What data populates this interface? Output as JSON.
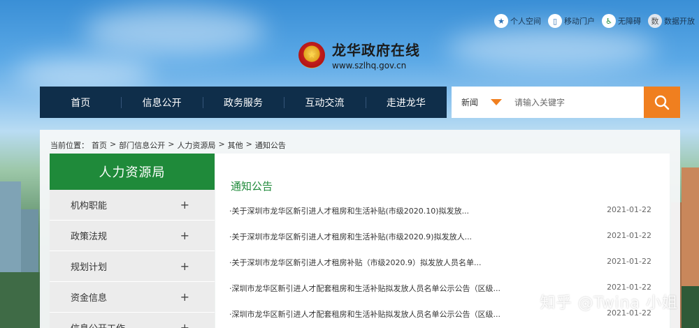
{
  "toplinks": [
    {
      "label": "个人空间",
      "icon": "star-person-icon"
    },
    {
      "label": "移动门户",
      "icon": "mobile-icon"
    },
    {
      "label": "无障碍",
      "icon": "wheelchair-icon"
    },
    {
      "label": "数据开放",
      "icon": "data-icon",
      "icon_text": "数"
    }
  ],
  "logo": {
    "title": "龙华政府在线",
    "url": "www.szlhq.gov.cn"
  },
  "nav": [
    "首页",
    "信息公开",
    "政务服务",
    "互动交流",
    "走进龙华"
  ],
  "search": {
    "category": "新闻",
    "placeholder": "请输入关键字"
  },
  "breadcrumb": {
    "prefix": "当前位置：",
    "items": [
      "首页",
      "部门信息公开",
      "人力资源局",
      "其他",
      "通知公告"
    ],
    "separator": ">"
  },
  "sidebar": {
    "title": "人力资源局",
    "items": [
      "机构职能",
      "政策法规",
      "规划计划",
      "资金信息",
      "信息公开工作"
    ]
  },
  "main": {
    "title": "通知公告",
    "news": [
      {
        "title": "·关于深圳市龙华区新引进人才租房和生活补贴(市级2020.10)拟发放...",
        "date": "2021-01-22"
      },
      {
        "title": "·关于深圳市龙华区新引进人才租房和生活补贴(市级2020.9)拟发放人...",
        "date": "2021-01-22"
      },
      {
        "title": "·关于深圳市龙华区新引进人才租房补贴（市级2020.9）拟发放人员名单...",
        "date": "2021-01-22"
      },
      {
        "title": "·深圳市龙华区新引进人才配套租房和生活补贴拟发放人员名单公示公告（区级...",
        "date": "2021-01-22"
      },
      {
        "title": "·深圳市龙华区新引进人才配套租房和生活补贴拟发放人员名单公示公告（区级...",
        "date": "2021-01-22"
      }
    ]
  },
  "watermark": "知乎 @Twina 小姐",
  "colors": {
    "nav_bg": "#0f2e4a",
    "accent_orange": "#f07f1f",
    "green": "#1f8a3a"
  }
}
